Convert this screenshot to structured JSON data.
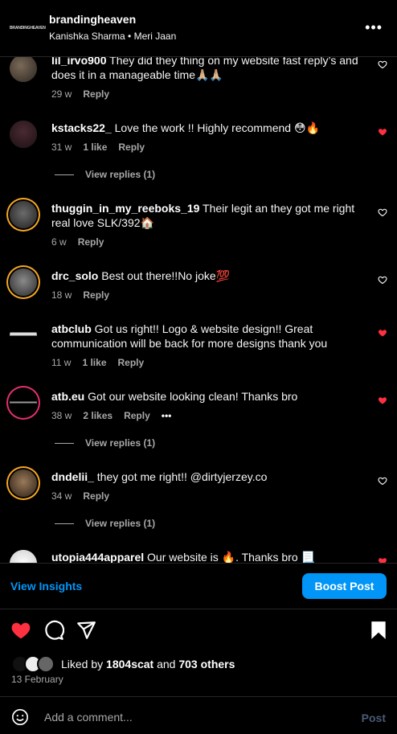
{
  "header": {
    "logo_text": "BRANDINGHEAVEN",
    "account": "brandingheaven",
    "subtitle": "Kanishka Sharma • Meri Jaan",
    "more": "•••"
  },
  "comments": [
    {
      "user": "lil_irvo900",
      "text": "They did they thing on my website fast reply’s and does it in a manageable time🙏🏼🙏🏼",
      "time": "29 w",
      "likes": "",
      "reply": "Reply",
      "liked": false,
      "view_replies": ""
    },
    {
      "user": "kstacks22_",
      "text": "Love the work !! Highly recommend 😳🔥",
      "time": "31 w",
      "likes": "1 like",
      "reply": "Reply",
      "liked": true,
      "view_replies": "View replies (1)"
    },
    {
      "user": "thuggin_in_my_reeboks_19",
      "text": "Their legit an they got me right real love SLK/392🏠",
      "time": "6 w",
      "likes": "",
      "reply": "Reply",
      "liked": false,
      "view_replies": ""
    },
    {
      "user": "drc_solo",
      "text": "Best out there!!No joke💯",
      "time": "18 w",
      "likes": "",
      "reply": "Reply",
      "liked": false,
      "view_replies": ""
    },
    {
      "user": "atbclub",
      "text": "Got us right!! Logo & website design!! Great communication will be back for more designs thank you",
      "time": "11 w",
      "likes": "1 like",
      "reply": "Reply",
      "liked": true,
      "view_replies": ""
    },
    {
      "user": "atb.eu",
      "text": "Got our website looking clean! Thanks bro",
      "time": "38 w",
      "likes": "2 likes",
      "reply": "Reply",
      "liked": true,
      "view_replies": "View replies (1)",
      "more": "•••"
    },
    {
      "user": "dndelii_",
      "text": "they got me right!! @dirtyjerzey.co",
      "time": "34 w",
      "likes": "",
      "reply": "Reply",
      "liked": false,
      "view_replies": "View replies (1)"
    },
    {
      "user": "utopia444apparel",
      "text": "Our website is 🔥. Thanks bro 📃",
      "time": "",
      "likes": "",
      "reply": "",
      "liked": true,
      "view_replies": ""
    }
  ],
  "insights": {
    "view_insights": "View Insights",
    "boost": "Boost Post"
  },
  "likes": {
    "prefix": "Liked by",
    "user": "1804scat",
    "and": "and",
    "others": "703 others"
  },
  "date": "13 February",
  "add_comment": {
    "placeholder": "Add a comment...",
    "post": "Post"
  },
  "colors": {
    "accent": "#0095f6",
    "like_red": "#ff3040",
    "bg": "#000000"
  }
}
